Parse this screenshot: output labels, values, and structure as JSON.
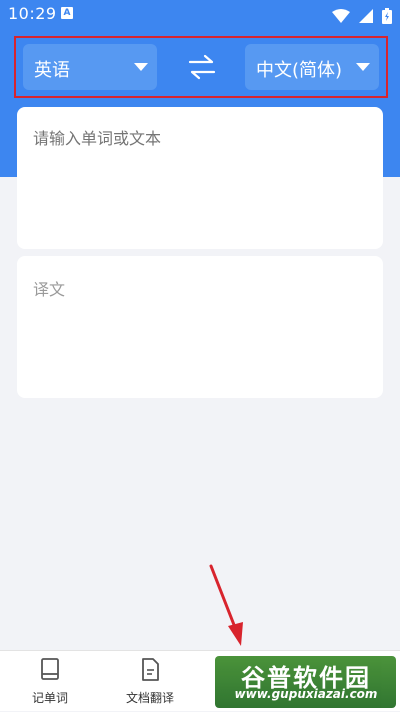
{
  "status_bar": {
    "time": "10:29",
    "notification_icon": "A"
  },
  "language_bar": {
    "source_language": "英语",
    "target_language": "中文(简体)",
    "swap_icon": "swap-arrows-icon"
  },
  "input_card": {
    "placeholder": "请输入单词或文本"
  },
  "output_card": {
    "placeholder": "译文"
  },
  "bottom_nav": {
    "items": [
      {
        "label": "记单词",
        "icon": "book-icon"
      },
      {
        "label": "文档翻译",
        "icon": "document-icon"
      },
      {
        "label": "",
        "icon": "nav-icon-3"
      },
      {
        "label": "",
        "icon": "nav-icon-4"
      }
    ]
  },
  "watermark": {
    "main": "谷普软件园",
    "sub": "www.gupuxiazai.com"
  },
  "colors": {
    "primary": "#3d86f0",
    "highlight_box": "#d8242d",
    "annotation_arrow": "#d8242d"
  }
}
